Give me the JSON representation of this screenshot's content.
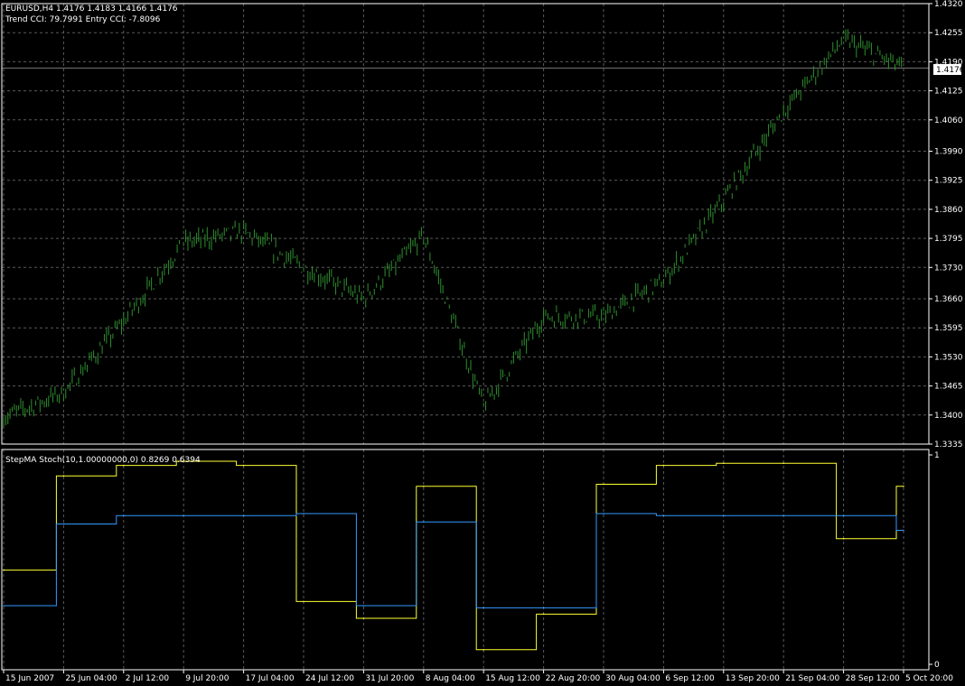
{
  "header": {
    "symbol_line": "EURUSD,H4  1.4176 1.4183 1.4166 1.4176",
    "cci_line": "Trend CCI: 79.7991 Entry CCI: -7.8096",
    "indicator_line": "StepMA Stoch(10,1.00000000,0) 0.8269 0.6394",
    "current_price": "1.4176"
  },
  "colors": {
    "background": "#000000",
    "price_bars": "#2f8f2f",
    "stoch_line": "#ffff33",
    "signal_line": "#3399ff",
    "grid": "#5a5a5a",
    "text": "#ffffff"
  },
  "chart_data": [
    {
      "type": "line",
      "title": "EURUSD,H4",
      "ylim": [
        1.3335,
        1.432
      ],
      "yticks": [
        "1.4320",
        "1.4255",
        "1.4190",
        "1.4125",
        "1.4060",
        "1.3990",
        "1.3925",
        "1.3860",
        "1.3795",
        "1.3730",
        "1.3660",
        "1.3595",
        "1.3530",
        "1.3465",
        "1.3400",
        "1.3335"
      ],
      "x": [
        "15 Jun 2007",
        "25 Jun 04:00",
        "2 Jul 12:00",
        "9 Jul 20:00",
        "17 Jul 04:00",
        "24 Jul 12:00",
        "31 Jul 20:00",
        "8 Aug 04:00",
        "15 Aug 12:00",
        "22 Aug 20:00",
        "30 Aug 04:00",
        "6 Sep 12:00",
        "13 Sep 20:00",
        "21 Sep 04:00",
        "28 Sep 12:00",
        "5 Oct 20:00"
      ],
      "series": [
        {
          "values": [
            1.3395,
            1.345,
            1.361,
            1.3785,
            1.381,
            1.373,
            1.366,
            1.38,
            1.342,
            1.362,
            1.362,
            1.37,
            1.388,
            1.408,
            1.424,
            1.4176
          ]
        }
      ],
      "last_value": 1.4176,
      "grid": true
    },
    {
      "type": "line",
      "title": "StepMA Stoch(10,1.00000000,0)",
      "ylim": [
        0,
        1
      ],
      "yticks": [
        "1",
        "0"
      ],
      "x": [
        "15 Jun 2007",
        "25 Jun 04:00",
        "2 Jul 12:00",
        "9 Jul 20:00",
        "17 Jul 04:00",
        "24 Jul 12:00",
        "31 Jul 20:00",
        "8 Aug 04:00",
        "15 Aug 12:00",
        "22 Aug 20:00",
        "30 Aug 04:00",
        "6 Sep 12:00",
        "13 Sep 20:00",
        "21 Sep 04:00",
        "28 Sep 12:00",
        "5 Oct 20:00"
      ],
      "series": [
        {
          "values": [
            0.45,
            0.9,
            0.95,
            0.97,
            0.95,
            0.3,
            0.22,
            0.85,
            0.07,
            0.24,
            0.86,
            0.95,
            0.96,
            0.96,
            0.6,
            0.85
          ]
        },
        {
          "values": [
            0.28,
            0.67,
            0.71,
            0.71,
            0.71,
            0.72,
            0.28,
            0.68,
            0.27,
            0.27,
            0.72,
            0.71,
            0.71,
            0.71,
            0.71,
            0.64
          ]
        }
      ],
      "last_values": [
        0.8269,
        0.6394
      ],
      "grid": true
    }
  ]
}
